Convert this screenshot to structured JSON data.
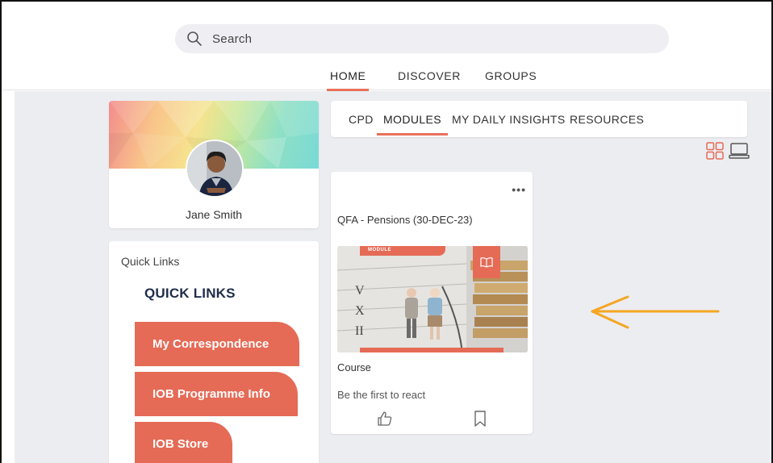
{
  "search": {
    "placeholder": "Search"
  },
  "nav": {
    "items": [
      {
        "label": "HOME",
        "active": true
      },
      {
        "label": "DISCOVER"
      },
      {
        "label": "GROUPS"
      }
    ]
  },
  "profile": {
    "name": "Jane Smith"
  },
  "quick_links": {
    "small_title": "Quick Links",
    "heading": "QUICK LINKS",
    "buttons": [
      "My Correspondence",
      "IOB Programme Info",
      "IOB Store"
    ]
  },
  "tabs": {
    "items": [
      {
        "label": "CPD"
      },
      {
        "label": "MODULES",
        "active": true
      },
      {
        "label": "MY DAILY INSIGHTS"
      },
      {
        "label": "RESOURCES"
      }
    ]
  },
  "module_card": {
    "menu": "•••",
    "title": "QFA - Pensions (30-DEC-23)",
    "badge": "MODULE",
    "type": "Course",
    "reaction_text": "Be the first to react"
  },
  "colors": {
    "accent": "#e56b56",
    "arrow": "#f5a623",
    "background": "#ecedf1",
    "heading": "#1f2d4a"
  }
}
